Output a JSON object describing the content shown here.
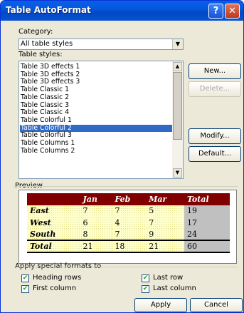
{
  "window": {
    "title": "Table AutoFormat"
  },
  "titlebar": {
    "help_glyph": "?",
    "close_glyph": "✕"
  },
  "category": {
    "label": "Category:",
    "value": "All table styles"
  },
  "table_styles": {
    "label": "Table styles:",
    "items": [
      "Table 3D effects 1",
      "Table 3D effects 2",
      "Table 3D effects 3",
      "Table Classic 1",
      "Table Classic 2",
      "Table Classic 3",
      "Table Classic 4",
      "Table Colorful 1",
      "Table Colorful 2",
      "Table Colorful 3",
      "Table Columns 1",
      "Table Columns 2"
    ],
    "selected_index": 8
  },
  "buttons": {
    "new": "New...",
    "delete": "Delete...",
    "modify": "Modify...",
    "default": "Default...",
    "apply": "Apply",
    "cancel": "Cancel"
  },
  "preview": {
    "label": "Preview",
    "headers": [
      "",
      "Jan",
      "Feb",
      "Mar",
      "Total"
    ],
    "rows": [
      [
        "East",
        "7",
        "7",
        "5",
        "19"
      ],
      [
        "West",
        "6",
        "4",
        "7",
        "17"
      ],
      [
        "South",
        "8",
        "7",
        "9",
        "24"
      ],
      [
        "Total",
        "21",
        "18",
        "21",
        "60"
      ]
    ],
    "colors": {
      "header_bg": "#800000",
      "body_bg": "#ffffcc",
      "total_col_bg": "#c0c0c0"
    }
  },
  "special_formats": {
    "label": "Apply special formats to",
    "heading_rows": {
      "label": "Heading rows",
      "checked": true
    },
    "first_column": {
      "label": "First column",
      "checked": true
    },
    "last_row": {
      "label": "Last row",
      "checked": true
    },
    "last_column": {
      "label": "Last column",
      "checked": true
    }
  },
  "colors": {
    "title_bar": "#0458dc",
    "selection": "#316ac5",
    "dialog_bg": "#ece9d8"
  }
}
